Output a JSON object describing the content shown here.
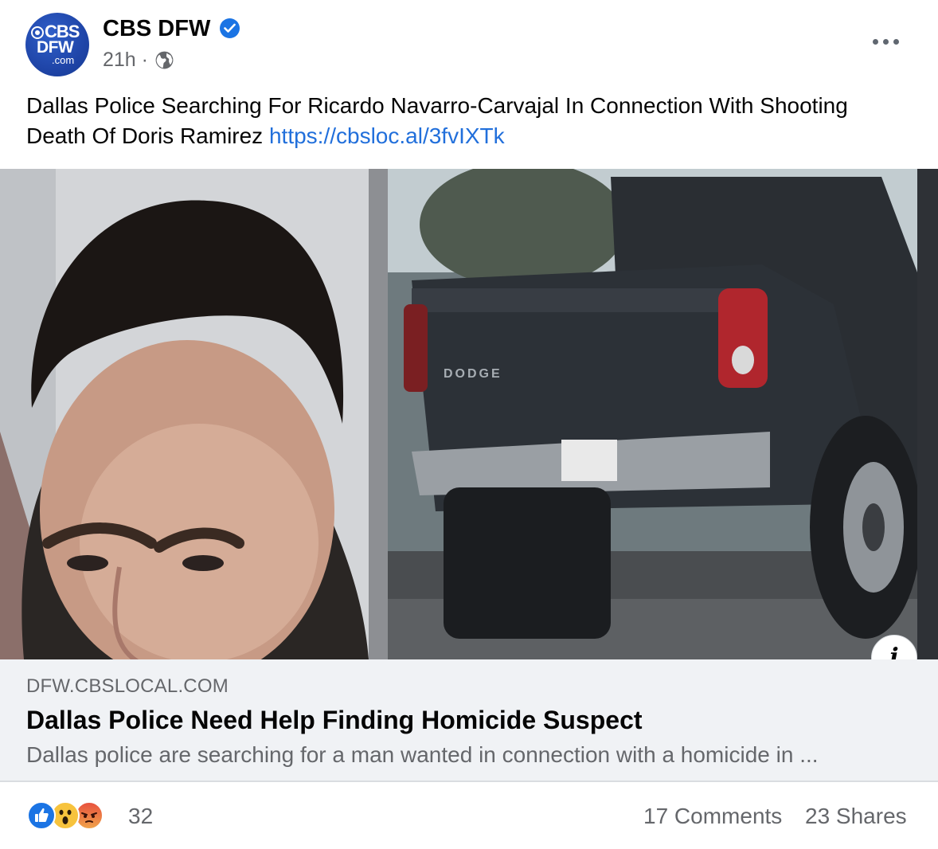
{
  "post": {
    "page_name": "CBS DFW",
    "avatar": {
      "line1": "CBS",
      "line2": "DFW",
      "line3": ".com"
    },
    "timestamp": "21h",
    "separator": "·",
    "audience_icon": "globe-icon",
    "text": "Dallas Police Searching For Ricardo Navarro-Carvajal In Connection With Shooting Death Of Doris Ramirez",
    "link": "https://cbsloc.al/3fvIXTk"
  },
  "link_preview": {
    "domain": "DFW.CBSLOCAL.COM",
    "title": "Dallas Police Need Help Finding Homicide Suspect",
    "description": "Dallas police are searching for a man wanted in connection with a homicide in ...",
    "info_icon": "i",
    "truck_badge": "DODGE"
  },
  "engagement": {
    "reactions": [
      "like-reaction",
      "wow-reaction",
      "angry-reaction"
    ],
    "reaction_count": "32",
    "comments": "17 Comments",
    "shares": "23 Shares"
  },
  "colors": {
    "link_blue": "#216fdb",
    "verified_blue": "#1b74e4",
    "secondary_text": "#65676b",
    "preview_bg": "#f0f2f5",
    "avatar_blue": "#1f45a8"
  }
}
